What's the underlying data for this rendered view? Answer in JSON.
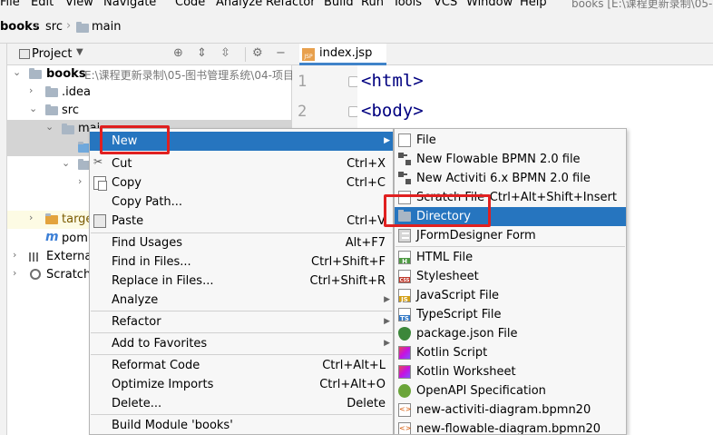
{
  "menubar": {
    "items": [
      "File",
      "Edit",
      "View",
      "Navigate",
      "Code",
      "Analyze",
      "Refactor",
      "Build",
      "Run",
      "Tools",
      "VCS",
      "Window",
      "Help"
    ],
    "window_title": "books [E:\\课程更新录制\\05-"
  },
  "breadcrumb": {
    "items": [
      "books",
      "src",
      "main"
    ]
  },
  "project_panel": {
    "title": "Project",
    "tree": [
      {
        "label": "books",
        "path": "E:\\课程更新录制\\05-图书管理系统\\04-项目"
      },
      {
        "label": ".idea"
      },
      {
        "label": "src"
      },
      {
        "label": "mai"
      },
      {
        "label": "targe"
      },
      {
        "label": "pom."
      },
      {
        "label": "External"
      },
      {
        "label": "Scratche"
      }
    ]
  },
  "editor": {
    "tab": "index.jsp",
    "tab_badge": "JSP",
    "lines": [
      {
        "num": "1",
        "code": "<html>"
      },
      {
        "num": "2",
        "code": "<body>"
      }
    ]
  },
  "context_menu": {
    "items": [
      {
        "label": "New",
        "shortcut": "",
        "submenu": true,
        "highlighted": true
      },
      {
        "label": "Cut",
        "shortcut": "Ctrl+X"
      },
      {
        "label": "Copy",
        "shortcut": "Ctrl+C"
      },
      {
        "label": "Copy Path...",
        "shortcut": ""
      },
      {
        "label": "Paste",
        "shortcut": "Ctrl+V"
      },
      {
        "label": "Find Usages",
        "shortcut": "Alt+F7"
      },
      {
        "label": "Find in Files...",
        "shortcut": "Ctrl+Shift+F"
      },
      {
        "label": "Replace in Files...",
        "shortcut": "Ctrl+Shift+R"
      },
      {
        "label": "Analyze",
        "shortcut": "",
        "submenu": true
      },
      {
        "label": "Refactor",
        "shortcut": "",
        "submenu": true
      },
      {
        "label": "Add to Favorites",
        "shortcut": "",
        "submenu": true
      },
      {
        "label": "Reformat Code",
        "shortcut": "Ctrl+Alt+L"
      },
      {
        "label": "Optimize Imports",
        "shortcut": "Ctrl+Alt+O"
      },
      {
        "label": "Delete...",
        "shortcut": "Delete"
      },
      {
        "label": "Build Module 'books'",
        "shortcut": ""
      }
    ]
  },
  "submenu": {
    "items": [
      {
        "label": "File",
        "icon": "file-icon"
      },
      {
        "label": "New Flowable BPMN 2.0 file",
        "icon": "bpmn-icon"
      },
      {
        "label": "New Activiti 6.x BPMN 2.0 file",
        "icon": "bpmn-icon"
      },
      {
        "label": "Scratch File",
        "shortcut": "Ctrl+Alt+Shift+Insert",
        "icon": "scratch-file-icon"
      },
      {
        "label": "Directory",
        "icon": "folder-icon",
        "highlighted": true
      },
      {
        "label": "JFormDesigner Form",
        "icon": "form-icon"
      },
      {
        "label": "HTML File",
        "icon": "html-file-icon",
        "badge": "H"
      },
      {
        "label": "Stylesheet",
        "icon": "css-file-icon",
        "badge": "CSS"
      },
      {
        "label": "JavaScript File",
        "icon": "js-file-icon",
        "badge": "JS"
      },
      {
        "label": "TypeScript File",
        "icon": "ts-file-icon",
        "badge": "TS"
      },
      {
        "label": "package.json File",
        "icon": "npm-icon"
      },
      {
        "label": "Kotlin Script",
        "icon": "kotlin-icon"
      },
      {
        "label": "Kotlin Worksheet",
        "icon": "kotlin-icon"
      },
      {
        "label": "OpenAPI Specification",
        "icon": "openapi-icon"
      },
      {
        "label": "new-activiti-diagram.bpmn20",
        "icon": "code-file-icon"
      },
      {
        "label": "new-flowable-diagram.bpmn20",
        "icon": "code-file-icon"
      }
    ]
  },
  "colors": {
    "highlight": "#2675bf",
    "annotation": "#e02020",
    "tab_underline": "#4083c9"
  }
}
